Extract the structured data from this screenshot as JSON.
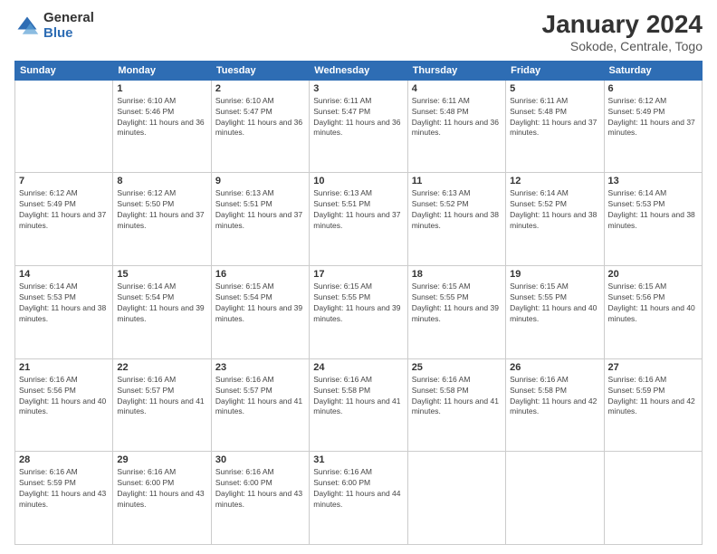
{
  "logo": {
    "general": "General",
    "blue": "Blue"
  },
  "title": "January 2024",
  "subtitle": "Sokode, Centrale, Togo",
  "days": [
    "Sunday",
    "Monday",
    "Tuesday",
    "Wednesday",
    "Thursday",
    "Friday",
    "Saturday"
  ],
  "weeks": [
    [
      {
        "num": "",
        "sunrise": "",
        "sunset": "",
        "daylight": ""
      },
      {
        "num": "1",
        "sunrise": "Sunrise: 6:10 AM",
        "sunset": "Sunset: 5:46 PM",
        "daylight": "Daylight: 11 hours and 36 minutes."
      },
      {
        "num": "2",
        "sunrise": "Sunrise: 6:10 AM",
        "sunset": "Sunset: 5:47 PM",
        "daylight": "Daylight: 11 hours and 36 minutes."
      },
      {
        "num": "3",
        "sunrise": "Sunrise: 6:11 AM",
        "sunset": "Sunset: 5:47 PM",
        "daylight": "Daylight: 11 hours and 36 minutes."
      },
      {
        "num": "4",
        "sunrise": "Sunrise: 6:11 AM",
        "sunset": "Sunset: 5:48 PM",
        "daylight": "Daylight: 11 hours and 36 minutes."
      },
      {
        "num": "5",
        "sunrise": "Sunrise: 6:11 AM",
        "sunset": "Sunset: 5:48 PM",
        "daylight": "Daylight: 11 hours and 37 minutes."
      },
      {
        "num": "6",
        "sunrise": "Sunrise: 6:12 AM",
        "sunset": "Sunset: 5:49 PM",
        "daylight": "Daylight: 11 hours and 37 minutes."
      }
    ],
    [
      {
        "num": "7",
        "sunrise": "Sunrise: 6:12 AM",
        "sunset": "Sunset: 5:49 PM",
        "daylight": "Daylight: 11 hours and 37 minutes."
      },
      {
        "num": "8",
        "sunrise": "Sunrise: 6:12 AM",
        "sunset": "Sunset: 5:50 PM",
        "daylight": "Daylight: 11 hours and 37 minutes."
      },
      {
        "num": "9",
        "sunrise": "Sunrise: 6:13 AM",
        "sunset": "Sunset: 5:51 PM",
        "daylight": "Daylight: 11 hours and 37 minutes."
      },
      {
        "num": "10",
        "sunrise": "Sunrise: 6:13 AM",
        "sunset": "Sunset: 5:51 PM",
        "daylight": "Daylight: 11 hours and 37 minutes."
      },
      {
        "num": "11",
        "sunrise": "Sunrise: 6:13 AM",
        "sunset": "Sunset: 5:52 PM",
        "daylight": "Daylight: 11 hours and 38 minutes."
      },
      {
        "num": "12",
        "sunrise": "Sunrise: 6:14 AM",
        "sunset": "Sunset: 5:52 PM",
        "daylight": "Daylight: 11 hours and 38 minutes."
      },
      {
        "num": "13",
        "sunrise": "Sunrise: 6:14 AM",
        "sunset": "Sunset: 5:53 PM",
        "daylight": "Daylight: 11 hours and 38 minutes."
      }
    ],
    [
      {
        "num": "14",
        "sunrise": "Sunrise: 6:14 AM",
        "sunset": "Sunset: 5:53 PM",
        "daylight": "Daylight: 11 hours and 38 minutes."
      },
      {
        "num": "15",
        "sunrise": "Sunrise: 6:14 AM",
        "sunset": "Sunset: 5:54 PM",
        "daylight": "Daylight: 11 hours and 39 minutes."
      },
      {
        "num": "16",
        "sunrise": "Sunrise: 6:15 AM",
        "sunset": "Sunset: 5:54 PM",
        "daylight": "Daylight: 11 hours and 39 minutes."
      },
      {
        "num": "17",
        "sunrise": "Sunrise: 6:15 AM",
        "sunset": "Sunset: 5:55 PM",
        "daylight": "Daylight: 11 hours and 39 minutes."
      },
      {
        "num": "18",
        "sunrise": "Sunrise: 6:15 AM",
        "sunset": "Sunset: 5:55 PM",
        "daylight": "Daylight: 11 hours and 39 minutes."
      },
      {
        "num": "19",
        "sunrise": "Sunrise: 6:15 AM",
        "sunset": "Sunset: 5:55 PM",
        "daylight": "Daylight: 11 hours and 40 minutes."
      },
      {
        "num": "20",
        "sunrise": "Sunrise: 6:15 AM",
        "sunset": "Sunset: 5:56 PM",
        "daylight": "Daylight: 11 hours and 40 minutes."
      }
    ],
    [
      {
        "num": "21",
        "sunrise": "Sunrise: 6:16 AM",
        "sunset": "Sunset: 5:56 PM",
        "daylight": "Daylight: 11 hours and 40 minutes."
      },
      {
        "num": "22",
        "sunrise": "Sunrise: 6:16 AM",
        "sunset": "Sunset: 5:57 PM",
        "daylight": "Daylight: 11 hours and 41 minutes."
      },
      {
        "num": "23",
        "sunrise": "Sunrise: 6:16 AM",
        "sunset": "Sunset: 5:57 PM",
        "daylight": "Daylight: 11 hours and 41 minutes."
      },
      {
        "num": "24",
        "sunrise": "Sunrise: 6:16 AM",
        "sunset": "Sunset: 5:58 PM",
        "daylight": "Daylight: 11 hours and 41 minutes."
      },
      {
        "num": "25",
        "sunrise": "Sunrise: 6:16 AM",
        "sunset": "Sunset: 5:58 PM",
        "daylight": "Daylight: 11 hours and 41 minutes."
      },
      {
        "num": "26",
        "sunrise": "Sunrise: 6:16 AM",
        "sunset": "Sunset: 5:58 PM",
        "daylight": "Daylight: 11 hours and 42 minutes."
      },
      {
        "num": "27",
        "sunrise": "Sunrise: 6:16 AM",
        "sunset": "Sunset: 5:59 PM",
        "daylight": "Daylight: 11 hours and 42 minutes."
      }
    ],
    [
      {
        "num": "28",
        "sunrise": "Sunrise: 6:16 AM",
        "sunset": "Sunset: 5:59 PM",
        "daylight": "Daylight: 11 hours and 43 minutes."
      },
      {
        "num": "29",
        "sunrise": "Sunrise: 6:16 AM",
        "sunset": "Sunset: 6:00 PM",
        "daylight": "Daylight: 11 hours and 43 minutes."
      },
      {
        "num": "30",
        "sunrise": "Sunrise: 6:16 AM",
        "sunset": "Sunset: 6:00 PM",
        "daylight": "Daylight: 11 hours and 43 minutes."
      },
      {
        "num": "31",
        "sunrise": "Sunrise: 6:16 AM",
        "sunset": "Sunset: 6:00 PM",
        "daylight": "Daylight: 11 hours and 44 minutes."
      },
      {
        "num": "",
        "sunrise": "",
        "sunset": "",
        "daylight": ""
      },
      {
        "num": "",
        "sunrise": "",
        "sunset": "",
        "daylight": ""
      },
      {
        "num": "",
        "sunrise": "",
        "sunset": "",
        "daylight": ""
      }
    ]
  ]
}
